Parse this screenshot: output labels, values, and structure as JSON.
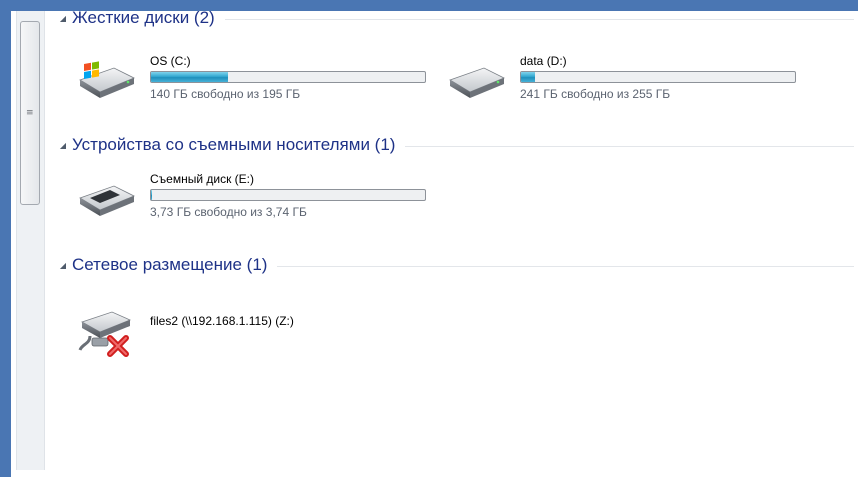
{
  "groups": [
    {
      "title": "Жесткие диски (2)"
    },
    {
      "title": "Устройства со съемными носителями (1)"
    },
    {
      "title": "Сетевое размещение (1)"
    }
  ],
  "drives": {
    "c": {
      "name": "OS (C:)",
      "info": "140 ГБ свободно из 195 ГБ",
      "used_fraction": 0.28,
      "icon": "windows-drive-icon"
    },
    "d": {
      "name": "data (D:)",
      "info": "241 ГБ свободно из 255 ГБ",
      "used_fraction": 0.05,
      "icon": "hard-drive-icon"
    },
    "e": {
      "name": "Съемный диск (E:)",
      "info": "3,73 ГБ свободно из 3,74 ГБ",
      "used_fraction": 0.003,
      "icon": "removable-drive-icon"
    },
    "z": {
      "name": "files2 (\\\\192.168.1.115) (Z:)",
      "icon": "disconnected-network-drive-icon"
    }
  },
  "colors": {
    "frame": "#4a76b3",
    "group_title": "#1e3287",
    "bar_fill": "#2a9fcb",
    "disconnected_x": "#d11f1f"
  }
}
